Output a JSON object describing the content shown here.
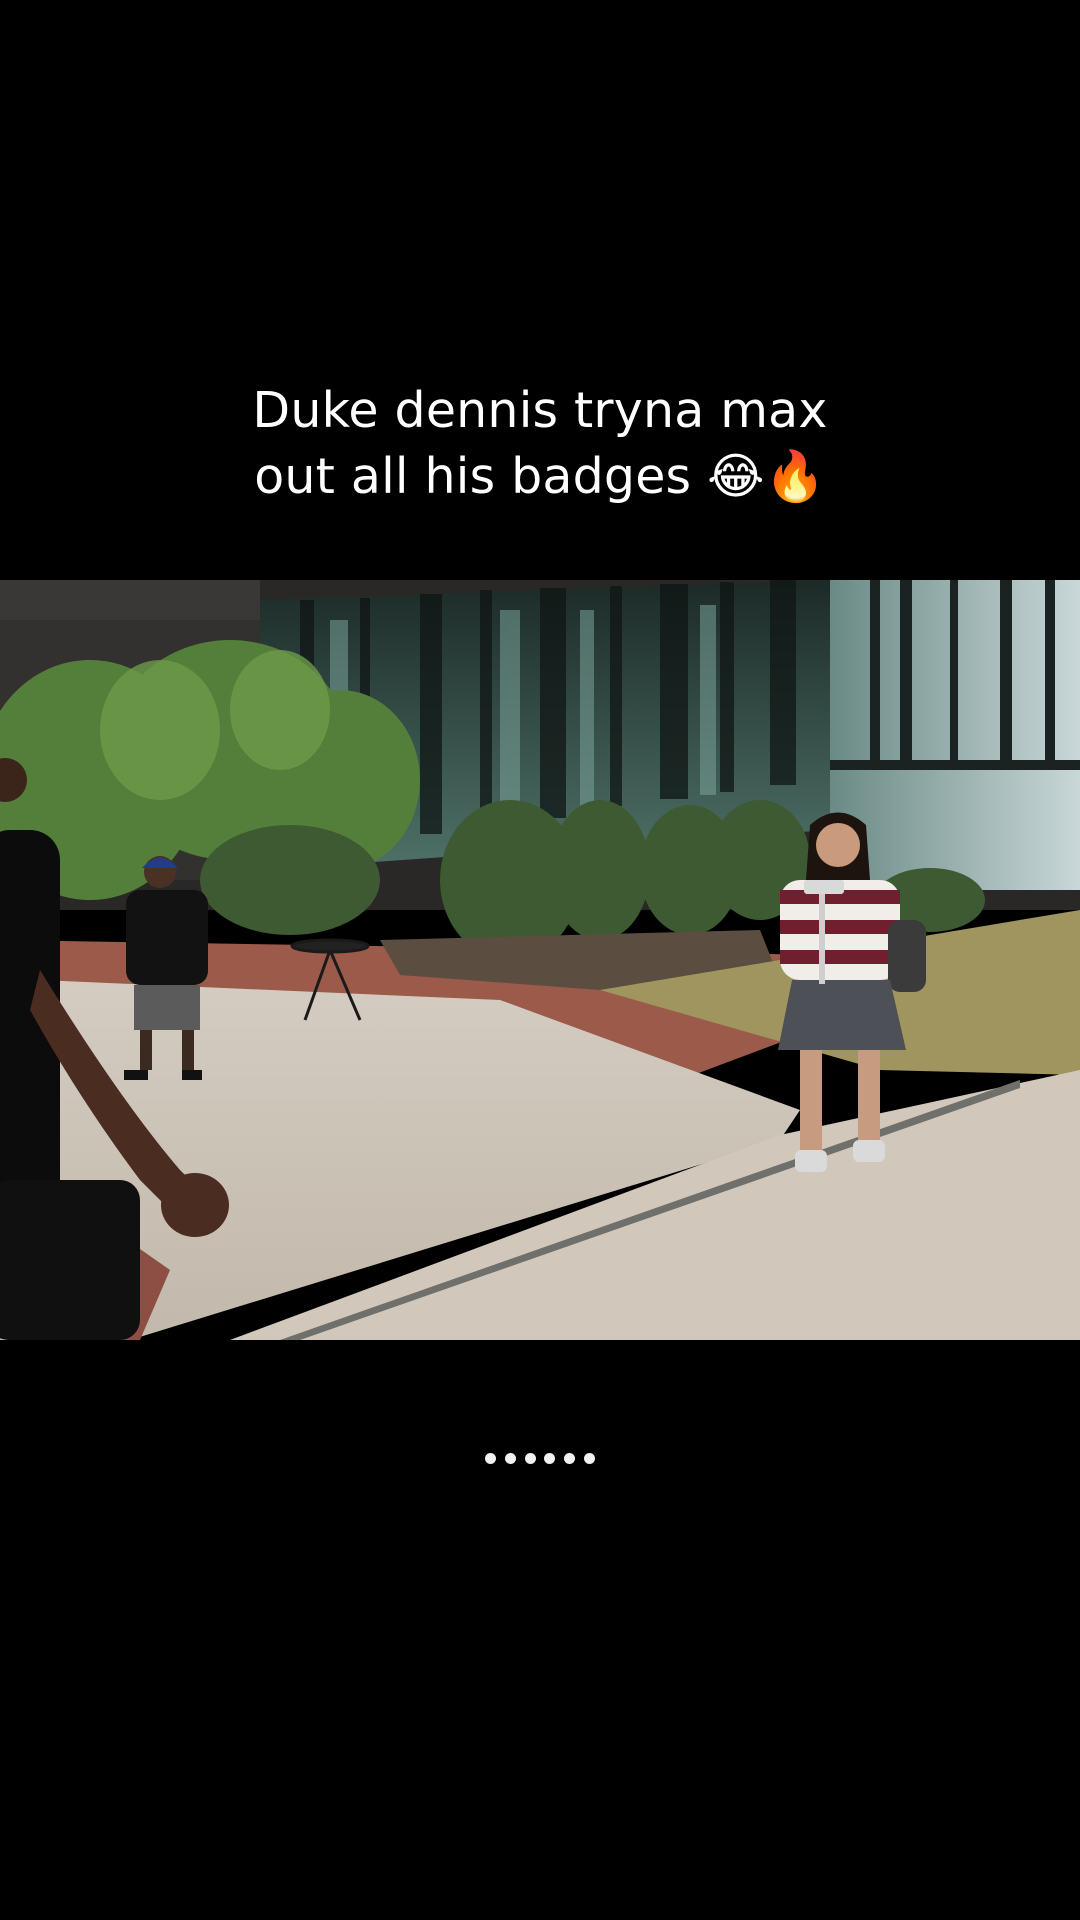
{
  "post": {
    "caption_line1": "Duke dennis tryna max",
    "caption_line2": "out all his badges 😂🔥"
  },
  "video": {
    "scene": "campus-walkway",
    "colors": {
      "sky": "#b9c6c9",
      "glass": "#3c5a55",
      "glass_dark": "#16211f",
      "concrete": "#c9c0b4",
      "brick": "#9a5a4c",
      "grass": "#9d9466",
      "trees": "#4f7d3c"
    }
  },
  "loading_indicator": {
    "dot_count": 6,
    "icon": "loading-dots-icon"
  }
}
